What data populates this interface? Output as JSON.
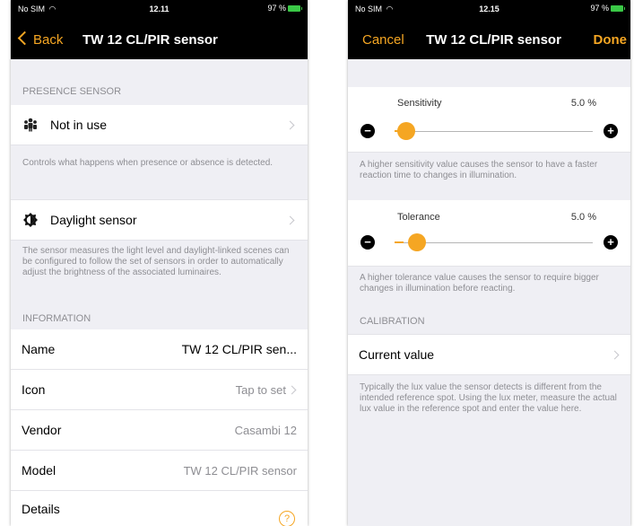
{
  "left": {
    "status": {
      "carrier": "No SIM",
      "time": "12.11",
      "battery": "97 %"
    },
    "nav": {
      "back_label": "Back",
      "title": "TW 12 CL/PIR sensor"
    },
    "presence": {
      "header": "PRESENCE SENSOR",
      "row_label": "Not in use",
      "footer": "Controls what happens when presence or absence is detected."
    },
    "daylight": {
      "row_label": "Daylight sensor",
      "footer": "The sensor measures the light level and daylight-linked scenes can be configured to follow the set of sensors in order to automatically adjust the brightness of the associated luminaires."
    },
    "information": {
      "header": "INFORMATION",
      "rows": [
        {
          "label": "Name",
          "value": "TW 12 CL/PIR sen..."
        },
        {
          "label": "Icon",
          "value": "Tap to set"
        },
        {
          "label": "Vendor",
          "value": "Casambi 12"
        },
        {
          "label": "Model",
          "value": "TW 12 CL/PIR sensor"
        },
        {
          "label": "Details",
          "value": "?"
        }
      ]
    },
    "icons": [
      "people-icon",
      "daylight-icon",
      "chevron-right-icon",
      "help-icon"
    ]
  },
  "right": {
    "status": {
      "carrier": "No SIM",
      "time": "12.15",
      "battery": "97 %"
    },
    "nav": {
      "cancel_label": "Cancel",
      "title": "TW 12 CL/PIR sensor",
      "done_label": "Done"
    },
    "sensitivity": {
      "label": "Sensitivity",
      "value_text": "5.0 %",
      "level": 0.05,
      "footer": "A higher sensitivity value causes the sensor to have a faster reaction time to changes in illumination."
    },
    "tolerance": {
      "label": "Tolerance",
      "value_text": "5.0 %",
      "level": 0.05,
      "footer": "A higher tolerance value causes the sensor to require bigger changes in illumination before reacting."
    },
    "calibration": {
      "header": "CALIBRATION",
      "row_label": "Current value",
      "footer": "Typically the lux value the sensor detects is different from the intended reference spot. Using the lux meter, measure the actual lux value in the reference spot and enter the value here."
    },
    "controls": {
      "minus": "−",
      "plus": "+"
    }
  },
  "colors": {
    "accent": "#f5a623",
    "background": "#efeff4",
    "bar": "#000000",
    "battery": "#3ac846"
  }
}
